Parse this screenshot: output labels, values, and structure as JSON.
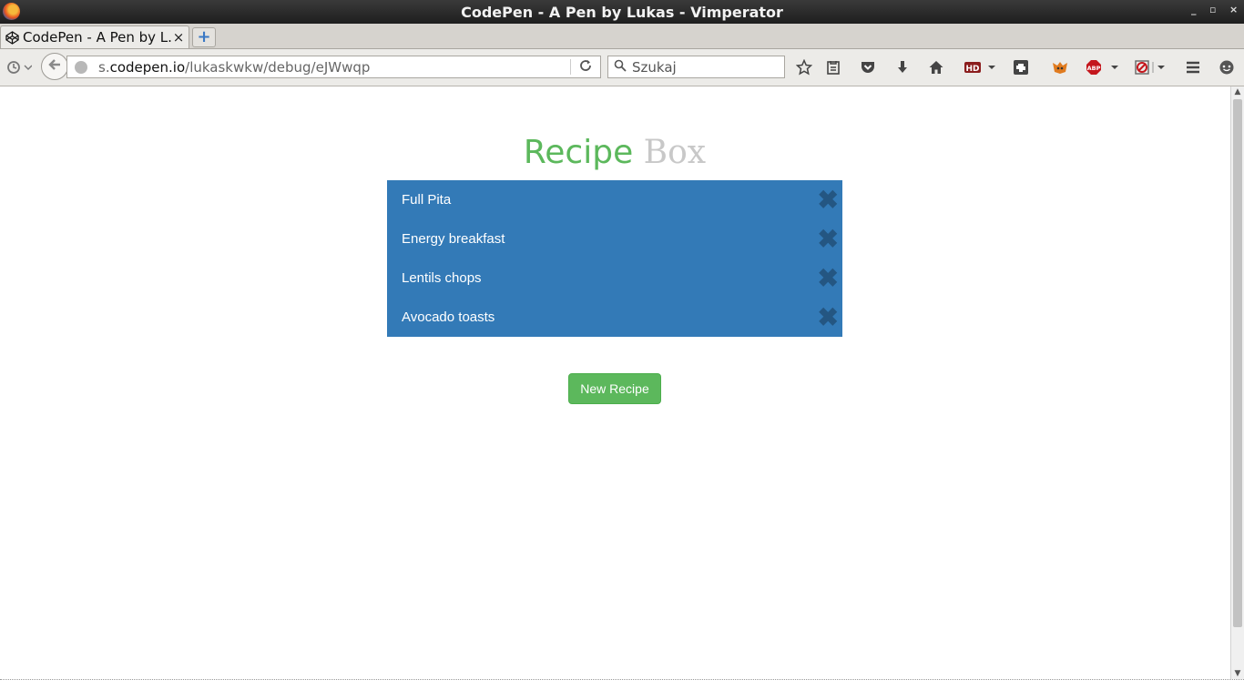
{
  "window": {
    "title": "CodePen - A Pen by Lukas - Vimperator",
    "controls": [
      "_",
      "▫",
      "×"
    ]
  },
  "tabs": [
    {
      "label": "CodePen - A Pen by L...",
      "close": "×"
    }
  ],
  "new_tab_label": "+",
  "nav": {
    "url_prefix": "s.",
    "url_host": "codepen.io",
    "url_path": "/lukaskwkw/debug/eJWwqp",
    "search_placeholder": "Szukaj"
  },
  "toolbar_icons": [
    "star-icon",
    "reading-list-icon",
    "pocket-icon",
    "download-icon",
    "home-icon",
    "hd-icon",
    "addon-icon",
    "foxyproxy-icon",
    "adblock-plus-icon",
    "noscript-icon",
    "menu-icon",
    "chat-icon"
  ],
  "page": {
    "heading_part1": "Recipe",
    "heading_part2": "Box",
    "recipes": [
      {
        "name": "Full Pita"
      },
      {
        "name": "Energy breakfast"
      },
      {
        "name": "Lentils chops"
      },
      {
        "name": "Avocado toasts"
      }
    ],
    "delete_glyph": "✖",
    "new_button": "New Recipe"
  },
  "colors": {
    "accent_green": "#5cb85c",
    "list_blue": "#337ab7",
    "delete_blue": "#245682",
    "heading_gray": "#c8c8c8"
  }
}
